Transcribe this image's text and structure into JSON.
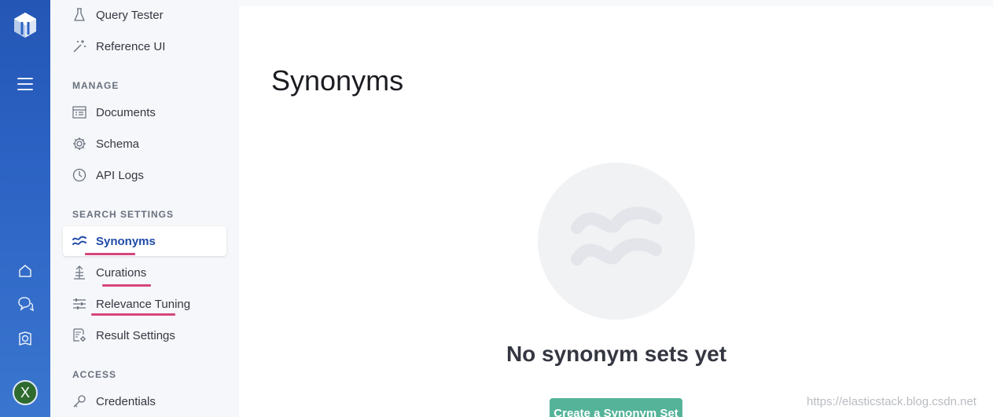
{
  "rail": {
    "logo_icon": "app-search-logo-icon",
    "menu_icon": "hamburger-menu-icon",
    "home_icon": "home-icon",
    "chat_icon": "chat-icon",
    "book_icon": "documentation-icon",
    "avatar_initial": "X",
    "avatar_color": "#2f6b2f"
  },
  "sidebar": {
    "items_top": [
      {
        "label": "Query Tester",
        "icon": "flask-icon"
      },
      {
        "label": "Reference UI",
        "icon": "magic-wand-icon"
      }
    ],
    "manage": {
      "title": "MANAGE",
      "items": [
        {
          "label": "Documents",
          "icon": "documents-icon"
        },
        {
          "label": "Schema",
          "icon": "gear-icon"
        },
        {
          "label": "API Logs",
          "icon": "clock-icon"
        }
      ]
    },
    "search_settings": {
      "title": "SEARCH SETTINGS",
      "items": [
        {
          "label": "Synonyms",
          "icon": "approx-icon",
          "active": true
        },
        {
          "label": "Curations",
          "icon": "curations-icon"
        },
        {
          "label": "Relevance Tuning",
          "icon": "sliders-icon"
        },
        {
          "label": "Result Settings",
          "icon": "result-settings-icon"
        }
      ]
    },
    "access": {
      "title": "ACCESS",
      "items": [
        {
          "label": "Credentials",
          "icon": "key-icon"
        }
      ]
    }
  },
  "main": {
    "page_title": "Synonyms",
    "empty_icon": "approx-icon",
    "empty_title": "No synonym sets yet",
    "create_button": "Create a Synonym Set"
  },
  "watermark": "https://elasticstack.blog.csdn.net",
  "colors": {
    "rail": "#2c63c4",
    "active_text": "#1f4aa8",
    "highlight_underline": "#d6457d",
    "primary_button": "#54b399"
  }
}
